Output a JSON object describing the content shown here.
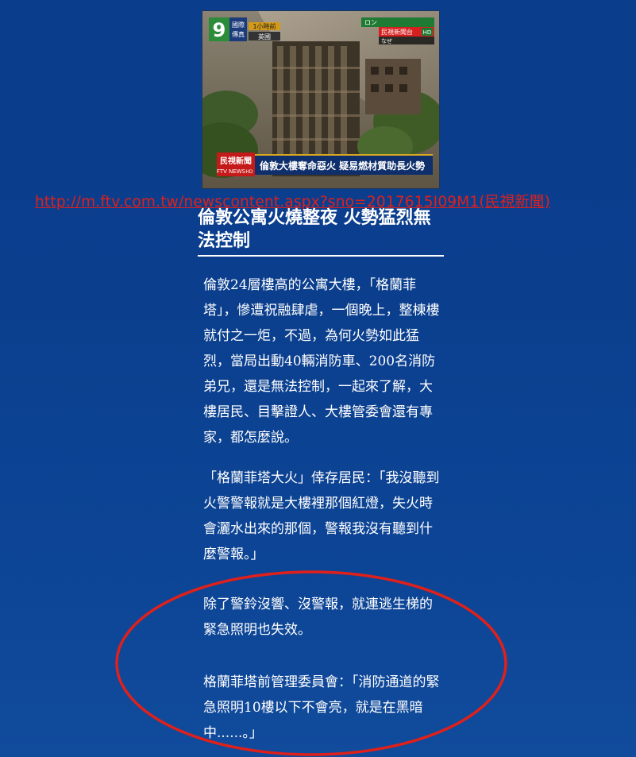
{
  "image": {
    "channel_logo": "9",
    "channel_label": "國際\n傳真",
    "time_badge": "1小時前",
    "location_badge": "英國",
    "top_right_caption_1": "ロン",
    "top_right_brand": "民視新聞台",
    "top_right_hd": "HD",
    "top_right_caption_2": "なぜ",
    "ticker_brand": "民視新聞",
    "ticker_brand_sub": "FTV NEWS",
    "ticker_hd": "HD",
    "ticker_headline": "倫敦大樓奪命惡火 疑易燃材質助長火勢"
  },
  "source_url": "http://m.ftv.com.tw/newscontent.aspx?sno=2017615I09M1(民視新聞)",
  "article": {
    "headline": "倫敦公寓火燒整夜 火勢猛烈無法控制",
    "paragraphs": [
      "倫敦24層樓高的公寓大樓，「格蘭菲塔」，慘遭祝融肆虐，一個晚上，整棟樓就付之一炬，不過，為何火勢如此猛烈，當局出動40輛消防車、200名消防弟兄，還是無法控制，一起來了解，大樓居民、目擊證人、大樓管委會還有專家，都怎麼說。",
      "「格蘭菲塔大火」倖存居民：「我沒聽到火警警報就是大樓裡那個紅燈，失火時會灑水出來的那個，警報我沒有聽到什麼警報。」",
      "除了警鈴沒響、沒警報，就連逃生梯的緊急照明也失效。",
      "格蘭菲塔前管理委員會：「消防通道的緊急照明10樓以下不會亮，就是在黑暗中......。」"
    ]
  },
  "colors": {
    "background": "#0b3f8e",
    "annotation_red": "#e0201a",
    "text": "#ffffff"
  }
}
